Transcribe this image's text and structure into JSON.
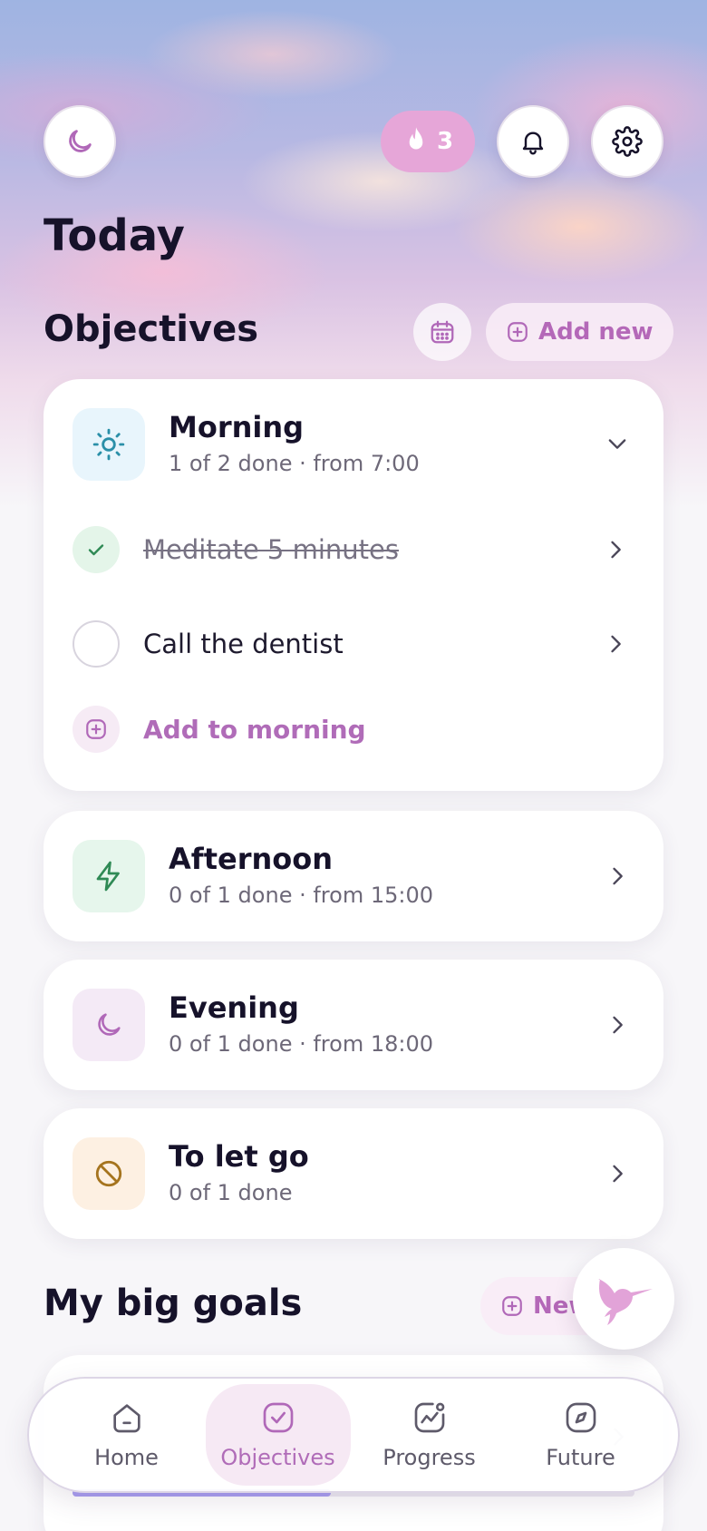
{
  "header": {
    "theme_icon": "moon-icon",
    "streak": {
      "icon": "flame-icon",
      "count": "3"
    },
    "notifications_icon": "bell-icon",
    "settings_icon": "gear-icon"
  },
  "page_title": "Today",
  "objectives": {
    "title": "Objectives",
    "calendar_icon": "calendar-icon",
    "add_label": "Add new",
    "groups": [
      {
        "name": "Morning",
        "meta": "1 of 2 done · from 7:00",
        "icon": "sun-icon",
        "expanded": true,
        "tasks": [
          {
            "label": "Meditate 5 minutes",
            "done": true
          },
          {
            "label": "Call the dentist",
            "done": false
          }
        ],
        "add_label": "Add to morning"
      },
      {
        "name": "Afternoon",
        "meta": "0 of 1 done · from 15:00",
        "icon": "lightning-icon",
        "expanded": false
      },
      {
        "name": "Evening",
        "meta": "0 of 1 done · from 18:00",
        "icon": "moon-icon",
        "expanded": false
      },
      {
        "name": "To let go",
        "meta": "0 of 1 done",
        "icon": "prohibited-icon",
        "expanded": false
      }
    ]
  },
  "big_goals": {
    "title": "My big goals",
    "add_label": "New",
    "peek": {
      "progress": 0.46
    }
  },
  "fab_icon": "hummingbird-icon",
  "nav": {
    "items": [
      {
        "label": "Home",
        "icon": "home-icon",
        "active": false
      },
      {
        "label": "Objectives",
        "icon": "check-square-icon",
        "active": true
      },
      {
        "label": "Progress",
        "icon": "chart-icon",
        "active": false
      },
      {
        "label": "Future",
        "icon": "compass-icon",
        "active": false
      }
    ]
  },
  "colors": {
    "accent": "#b06cb8",
    "streak": "#e6a6d8",
    "morning_icon_bg": "#e8f5fc",
    "afternoon_icon_bg": "#e6f6ec",
    "evening_icon_bg": "#f4eaf6",
    "letgo_icon_bg": "#fdf0e2"
  }
}
